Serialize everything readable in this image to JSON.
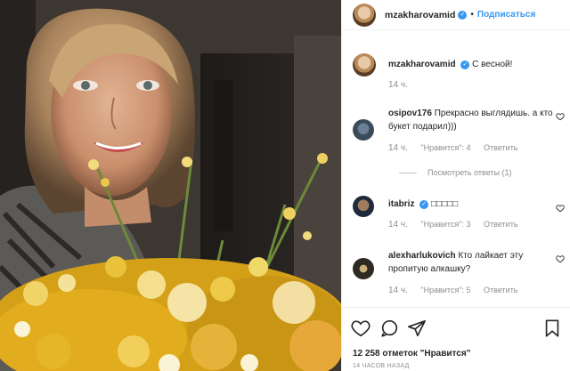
{
  "header": {
    "username": "mzakharovamid",
    "separator": "•",
    "follow_label": "Подписаться"
  },
  "caption": {
    "username": "mzakharovamid",
    "text": "С весной!",
    "time": "14 ч."
  },
  "comments": [
    {
      "username": "osipov176",
      "text": "Прекрасно выглядишь. а кто букет подарил)))",
      "time": "14 ч.",
      "likes_label": "\"Нравится\": 4",
      "reply_label": "Ответить",
      "view_replies": "Посмотреть ответы (1)",
      "verified": false
    },
    {
      "username": "itabriz",
      "text": "□□□□□",
      "time": "14 ч.",
      "likes_label": "\"Нравится\": 3",
      "reply_label": "Ответить",
      "verified": true
    },
    {
      "username": "alexharlukovich",
      "text": "Кто лайкает эту пропитую алкашку?",
      "time": "14 ч.",
      "likes_label": "\"Нравится\": 5",
      "reply_label": "Ответить",
      "verified": false
    }
  ],
  "footer": {
    "likes": "12 258 отметок \"Нравится\"",
    "timestamp": "14 ЧАСОВ НАЗАД"
  },
  "icons": {
    "like": "heart-outline-icon",
    "comment": "speech-bubble-icon",
    "share": "paper-plane-icon",
    "save": "bookmark-icon",
    "verified": "verified-badge-icon"
  },
  "colors": {
    "link_blue": "#3897f0",
    "secondary_text": "#8e8e8e",
    "divider": "#efefef"
  }
}
